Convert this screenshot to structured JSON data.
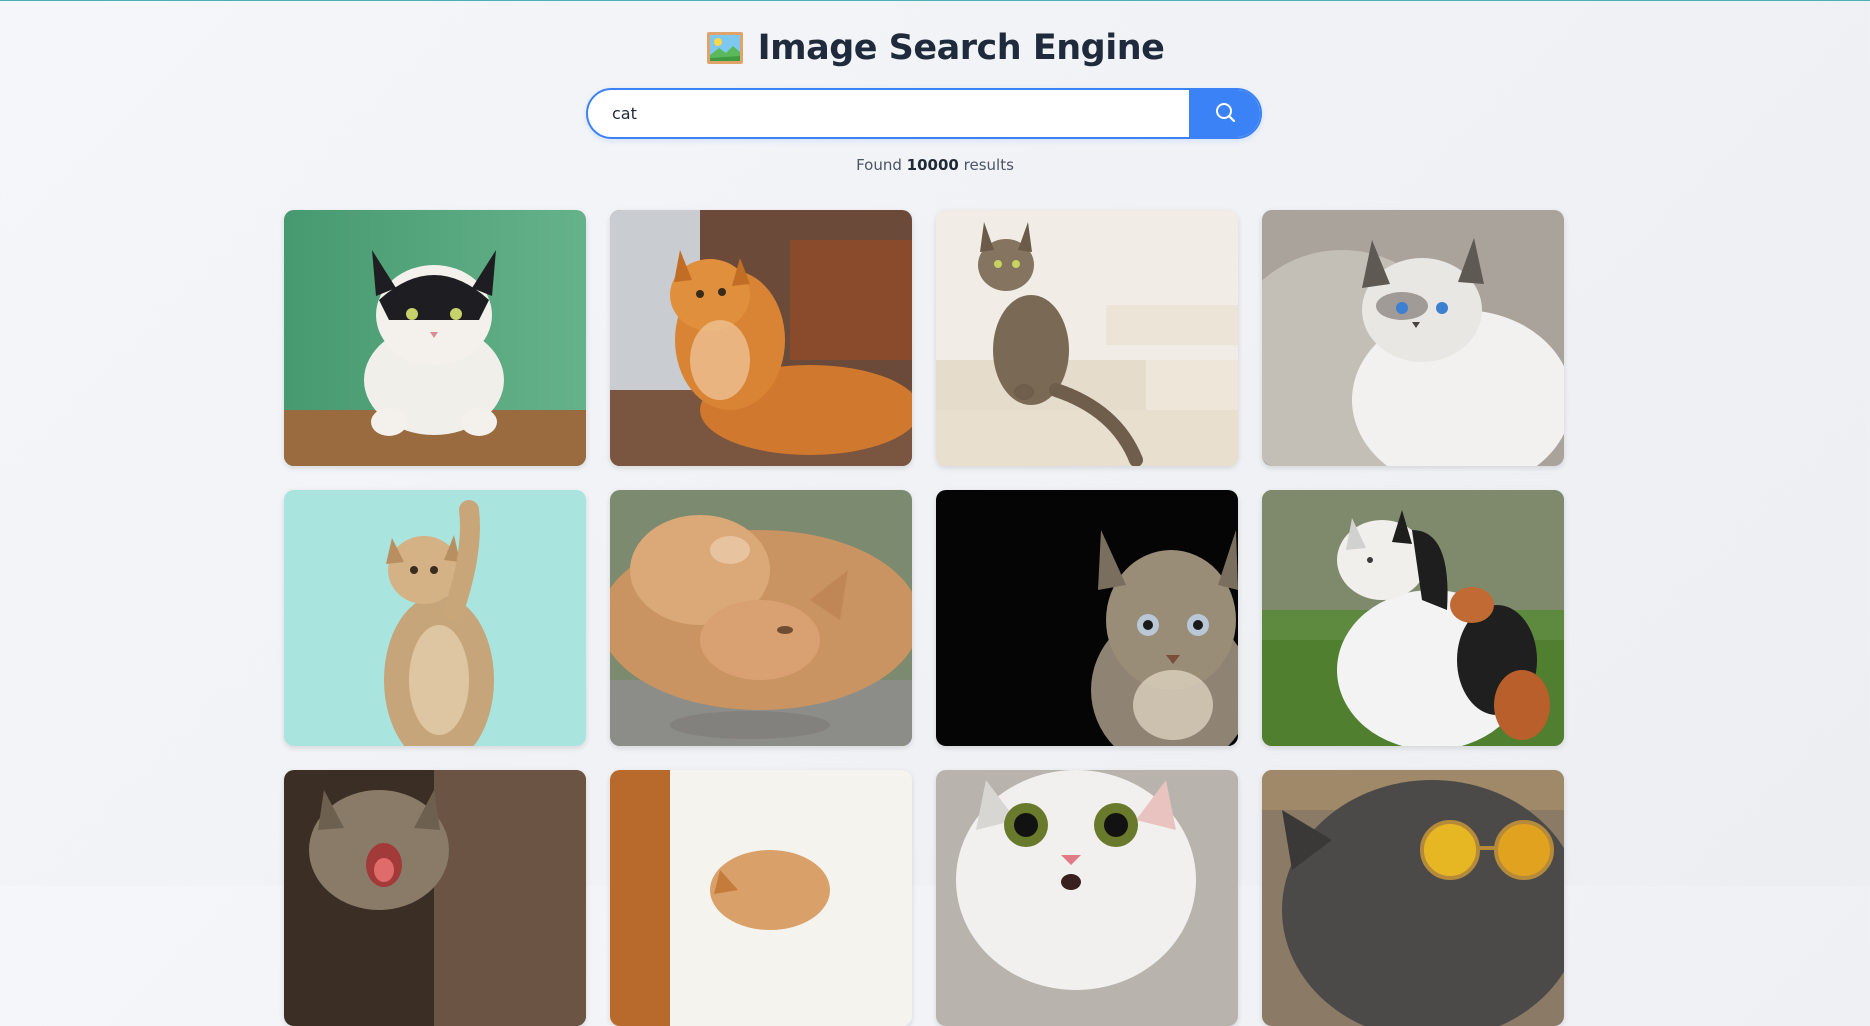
{
  "header": {
    "title": "Image Search Engine",
    "logo_icon": "framed-picture-icon"
  },
  "search": {
    "value": "cat",
    "placeholder": "",
    "button_icon": "search-icon"
  },
  "results": {
    "prefix": "Found",
    "count": "10000",
    "suffix": "results"
  },
  "images": [
    {
      "name": "black-white-cat-green-wall"
    },
    {
      "name": "orange-cat-lying"
    },
    {
      "name": "tabby-cat-on-stairs"
    },
    {
      "name": "white-cat-blue-eyes"
    },
    {
      "name": "kitten-raising-paw"
    },
    {
      "name": "fluffy-cat-rolling"
    },
    {
      "name": "tabby-cat-black-background"
    },
    {
      "name": "calico-cat-in-grass"
    },
    {
      "name": "kitten-yawning"
    },
    {
      "name": "orange-cat-partial"
    },
    {
      "name": "surprised-white-cat"
    },
    {
      "name": "cat-with-sunglasses"
    }
  ],
  "colors": {
    "accent": "#3b82f6",
    "title": "#1f2a3c",
    "background": "#f0f2f5"
  }
}
